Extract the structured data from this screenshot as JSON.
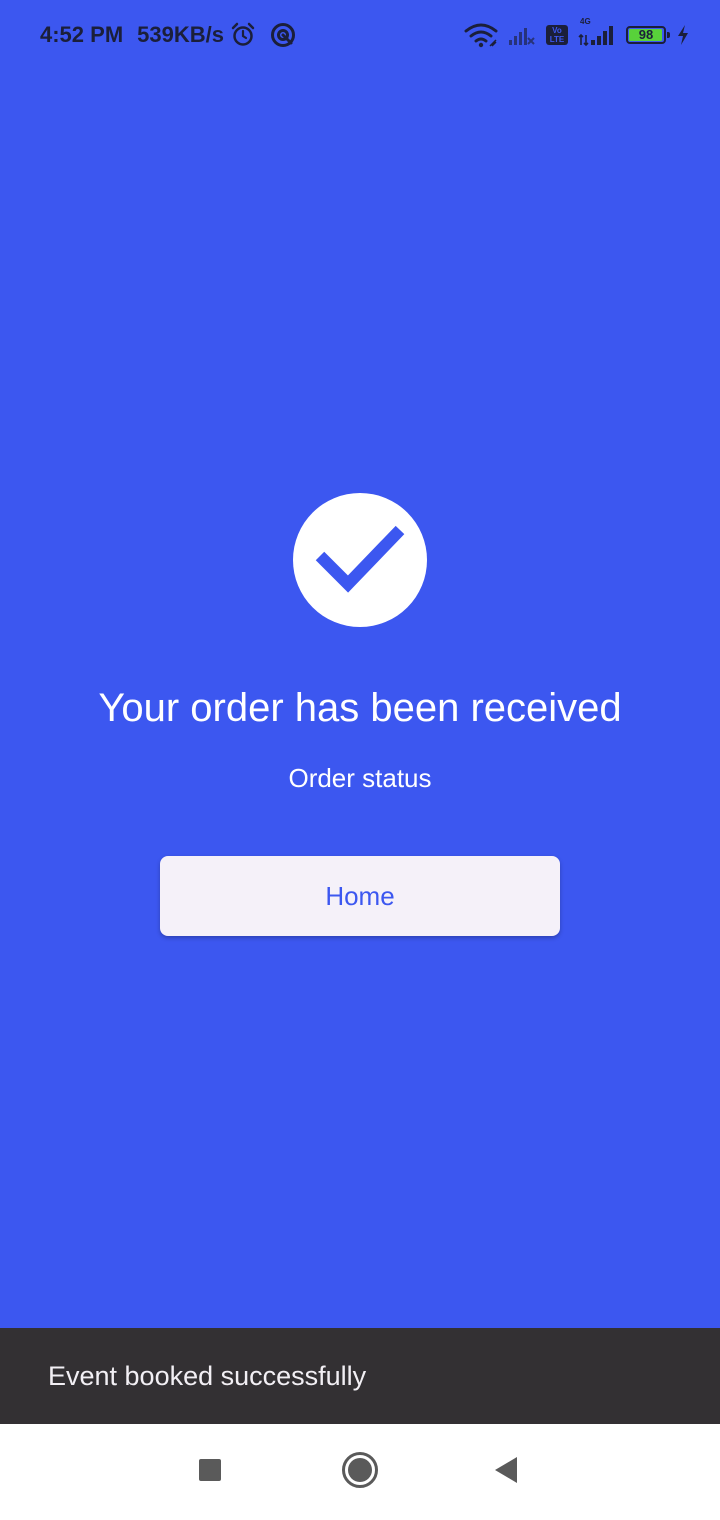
{
  "status_bar": {
    "time": "4:52 PM",
    "net_speed": "539KB/s",
    "network_type": "4G",
    "volte_top": "Vo",
    "volte_bottom": "LTE",
    "battery_level": "98",
    "icons": [
      "alarm-icon",
      "hotspot-icon",
      "wifi-icon",
      "signal-icon",
      "volte-icon",
      "signal-4g-icon",
      "battery-icon",
      "charging-icon"
    ]
  },
  "main": {
    "status_icon": "check-icon",
    "title": "Your order has been received",
    "subtitle": "Order status",
    "home_button_label": "Home"
  },
  "snackbar": {
    "message": "Event booked successfully"
  },
  "nav_bar": {
    "icons": [
      "recents-icon",
      "home-circle-icon",
      "back-icon"
    ]
  },
  "colors": {
    "background": "#3c57f0",
    "button_bg": "#f5f1f9",
    "snackbar_bg": "#333033",
    "battery_fill": "#58d23a"
  }
}
